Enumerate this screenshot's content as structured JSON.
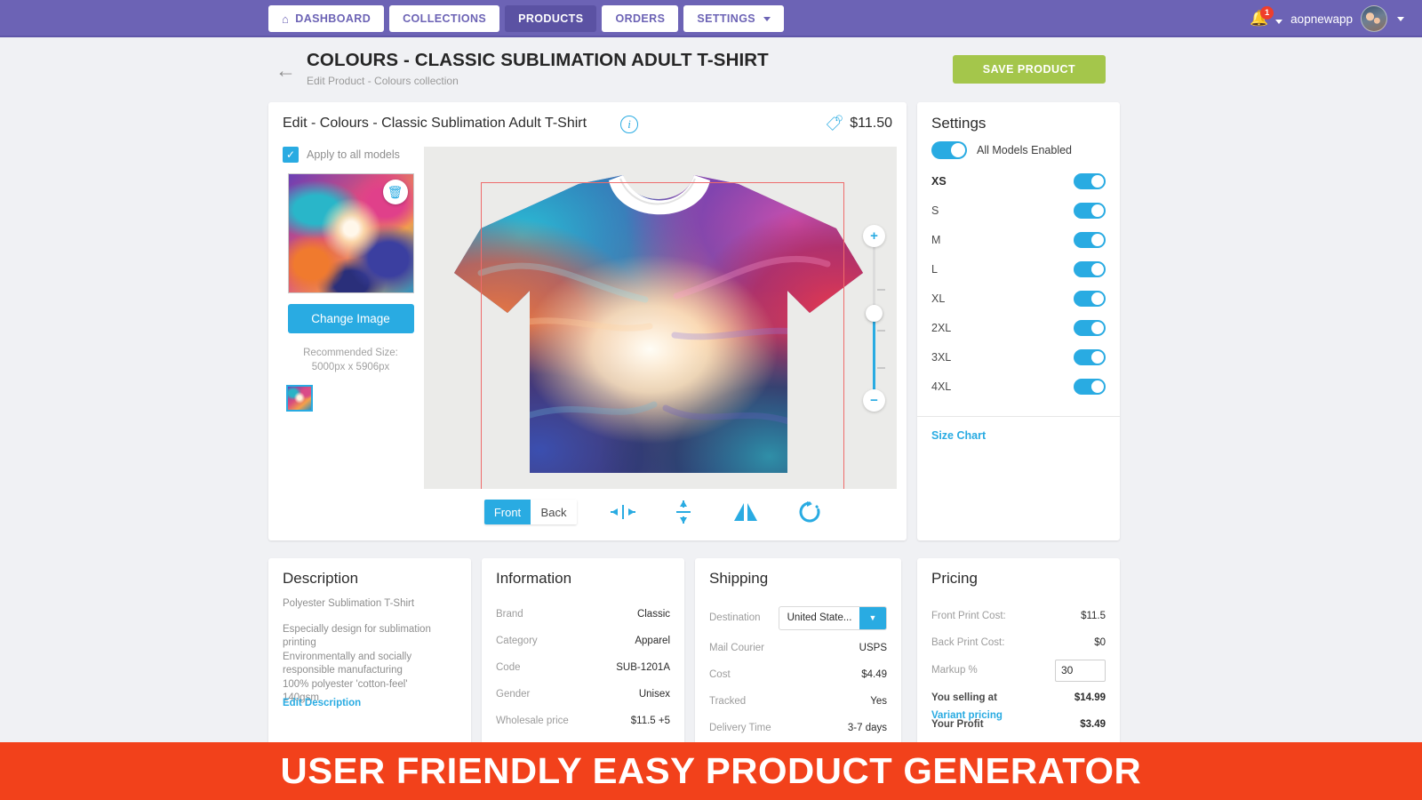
{
  "nav": {
    "items": [
      {
        "label": "DASHBOARD",
        "icon": "home-icon",
        "active": false
      },
      {
        "label": "COLLECTIONS",
        "icon": "",
        "active": false
      },
      {
        "label": "PRODUCTS",
        "icon": "",
        "active": true
      },
      {
        "label": "ORDERS",
        "icon": "",
        "active": false
      },
      {
        "label": "SETTINGS",
        "icon": "chevron-down-icon",
        "active": false
      }
    ],
    "notification_count": "1",
    "username": "aopnewapp",
    "accent_purple": "#6c63b5"
  },
  "header": {
    "title": "COLOURS - CLASSIC SUBLIMATION ADULT T-SHIRT",
    "subtitle": "Edit Product - Colours collection",
    "save_label": "SAVE PRODUCT",
    "save_color": "#a4c64b"
  },
  "editor": {
    "title": "Edit - Colours - Classic Sublimation Adult T-Shirt",
    "price": "$11.50",
    "apply_all_label": "Apply to all models",
    "apply_all_checked": true,
    "change_image_label": "Change Image",
    "recommended_size_label": "Recommended Size:",
    "recommended_size_value": "5000px x 5906px",
    "side_toggle": {
      "front": "Front",
      "back": "Back",
      "selected": "Front"
    },
    "tools": [
      "center-horizontal-icon",
      "center-vertical-icon",
      "mirror-flip-icon",
      "rotate-icon"
    ],
    "zoom": {
      "plus": "+",
      "minus": "−"
    },
    "accent_blue": "#29abe2",
    "design_box_color": "#ee6b6b"
  },
  "settings": {
    "title": "Settings",
    "all_models_label": "All Models Enabled",
    "all_models_enabled": true,
    "sizes": [
      {
        "label": "XS",
        "enabled": true,
        "bold": true
      },
      {
        "label": "S",
        "enabled": true,
        "bold": false
      },
      {
        "label": "M",
        "enabled": true,
        "bold": false
      },
      {
        "label": "L",
        "enabled": true,
        "bold": false
      },
      {
        "label": "XL",
        "enabled": true,
        "bold": false
      },
      {
        "label": "2XL",
        "enabled": true,
        "bold": false
      },
      {
        "label": "3XL",
        "enabled": true,
        "bold": false
      },
      {
        "label": "4XL",
        "enabled": true,
        "bold": false
      }
    ],
    "size_chart_label": "Size Chart"
  },
  "description": {
    "title": "Description",
    "line1": "Polyester Sublimation T-Shirt",
    "body": "Especially design for sublimation printing\nEnvironmentally and socially responsible manufacturing\n100% polyester 'cotton-feel'\n140gsm",
    "edit_link": "Edit Description"
  },
  "information": {
    "title": "Information",
    "rows": [
      {
        "key": "Brand",
        "value": "Classic"
      },
      {
        "key": "Category",
        "value": "Apparel"
      },
      {
        "key": "Code",
        "value": "SUB-1201A"
      },
      {
        "key": "Gender",
        "value": "Unisex"
      },
      {
        "key": "Wholesale price",
        "value": "$11.5 +5"
      }
    ]
  },
  "shipping": {
    "title": "Shipping",
    "destination_label": "Destination",
    "destination_value": "United State...",
    "rows": [
      {
        "key": "Mail Courier",
        "value": "USPS"
      },
      {
        "key": "Cost",
        "value": "$4.49"
      },
      {
        "key": "Tracked",
        "value": "Yes"
      },
      {
        "key": "Delivery Time",
        "value": "3-7 days"
      }
    ]
  },
  "pricing": {
    "title": "Pricing",
    "rows": [
      {
        "key": "Front Print Cost:",
        "value": "$11.5",
        "bold": false
      },
      {
        "key": "Back Print Cost:",
        "value": "$0",
        "bold": false
      }
    ],
    "markup_label": "Markup %",
    "markup_value": "30",
    "selling_label": "You selling at",
    "selling_value": "$14.99",
    "profit_label": "Your Profit",
    "profit_value": "$3.49",
    "variant_link": "Variant pricing"
  },
  "banner": {
    "text": "USER FRIENDLY EASY PRODUCT GENERATOR",
    "color": "#f2411b"
  }
}
